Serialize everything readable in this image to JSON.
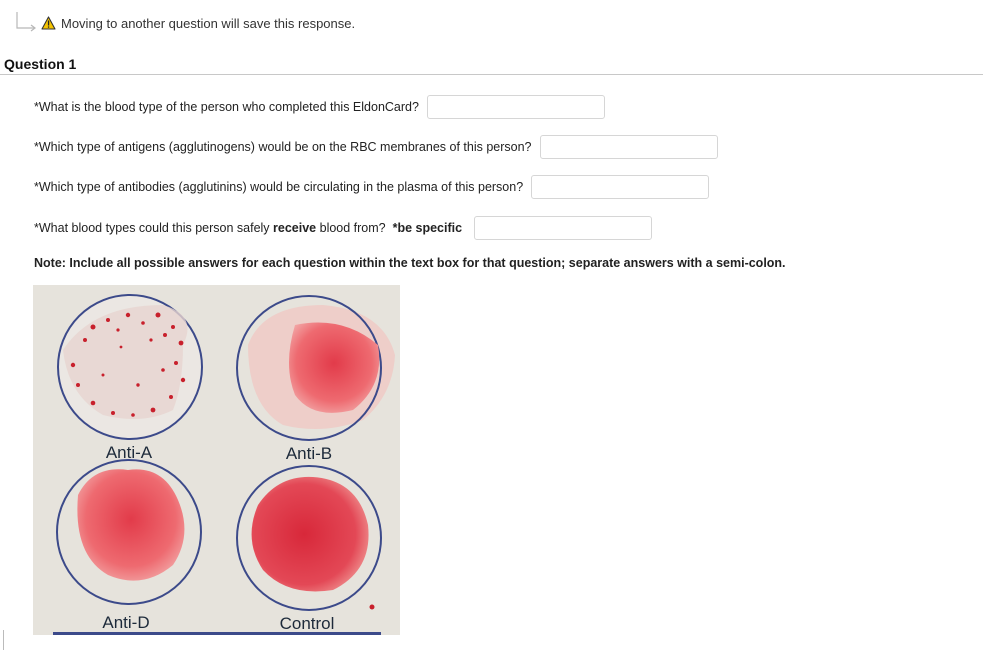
{
  "warning": {
    "message": "Moving to another question will save this response.",
    "arrow_icon": "return-arrow-icon",
    "warning_icon": "warning-triangle-icon"
  },
  "question": {
    "title": "Question 1",
    "items": [
      {
        "prompt": "*What is the blood type of the person who completed this EldonCard?",
        "value": ""
      },
      {
        "prompt": "*Which type of antigens (agglutinogens) would be on the RBC membranes of this person?",
        "value": ""
      },
      {
        "prompt": "*Which type of antibodies (agglutinins) would be circulating in the plasma of this person?",
        "value": ""
      },
      {
        "prompt_before": "*What blood types could this person safely ",
        "prompt_bold": "receive",
        "prompt_after": " blood from?  ",
        "prompt_bold2": "*be specific",
        "value": ""
      }
    ],
    "note": "Note: Include all possible answers for each question within the text box for that question; separate answers with a semi-colon."
  },
  "card": {
    "labels": [
      "Anti-A",
      "Anti-B",
      "Anti-D",
      "Control"
    ],
    "colors": {
      "background": "#e4e1da",
      "blood": "#e8505a",
      "ring": "#3c4a8a",
      "clump": "#c8202c"
    }
  }
}
